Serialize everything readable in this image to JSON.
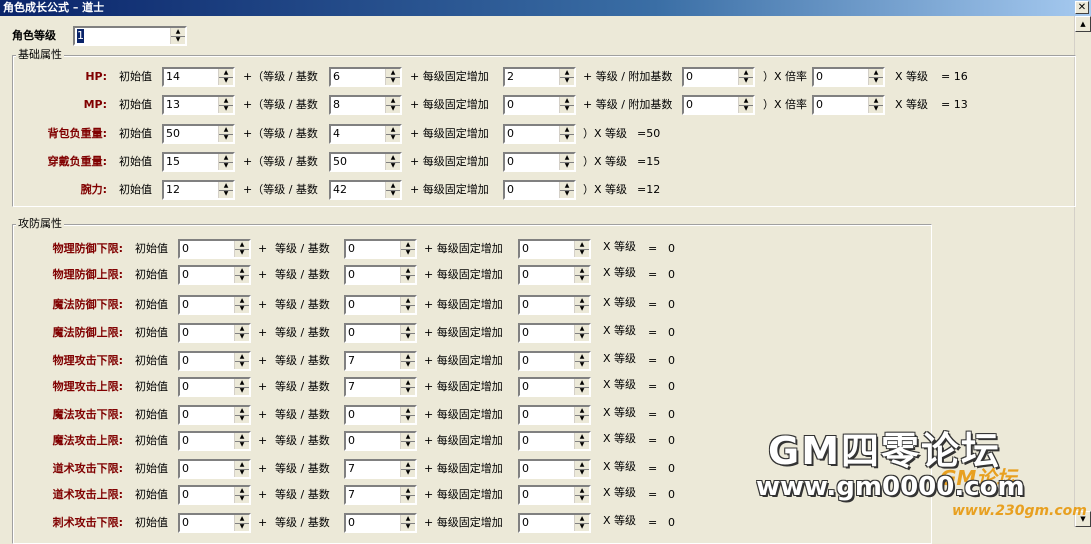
{
  "window": {
    "title": "角色成长公式 – 道士",
    "close": "✕"
  },
  "level": {
    "label": "角色等级",
    "value": "1"
  },
  "base_group": {
    "title": "基础属性",
    "rows": [
      {
        "name": "HP:",
        "init_label": "初始值",
        "init": "14",
        "p1": "+（等级 / 基数",
        "base": "6",
        "p2": "+ 每级固定增加",
        "inc": "2",
        "p3": "+ 等级 / 附加基数",
        "extra": "0",
        "p4": "）X 倍率",
        "mult": "0",
        "p5": "X 等级",
        "result": "=  16"
      },
      {
        "name": "MP:",
        "init_label": "初始值",
        "init": "13",
        "p1": "+（等级 / 基数",
        "base": "8",
        "p2": "+ 每级固定增加",
        "inc": "0",
        "p3": "+ 等级 / 附加基数",
        "extra": "0",
        "p4": "）X 倍率",
        "mult": "0",
        "p5": "X 等级",
        "result": "=  13"
      },
      {
        "name": "背包负重量:",
        "init_label": "初始值",
        "init": "50",
        "p1": "+（等级 / 基数",
        "base": "4",
        "p2": "+ 每级固定增加",
        "inc": "0",
        "p5": "）X 等级",
        "result": "=50"
      },
      {
        "name": "穿戴负重量:",
        "init_label": "初始值",
        "init": "15",
        "p1": "+（等级 / 基数",
        "base": "50",
        "p2": "+ 每级固定增加",
        "inc": "0",
        "p5": "）X 等级",
        "result": "=15"
      },
      {
        "name": "腕力:",
        "init_label": "初始值",
        "init": "12",
        "p1": "+（等级 / 基数",
        "base": "42",
        "p2": "+ 每级固定增加",
        "inc": "0",
        "p5": "）X 等级",
        "result": "=12"
      }
    ]
  },
  "combat_group": {
    "title": "攻防属性",
    "rows": [
      {
        "name": "物理防御下限:",
        "init": "0",
        "base": "0",
        "inc": "0",
        "result": "0"
      },
      {
        "name": "物理防御上限:",
        "init": "0",
        "base": "0",
        "inc": "0",
        "result": "0"
      },
      {
        "name": "魔法防御下限:",
        "init": "0",
        "base": "0",
        "inc": "0",
        "result": "0"
      },
      {
        "name": "魔法防御上限:",
        "init": "0",
        "base": "0",
        "inc": "0",
        "result": "0"
      },
      {
        "name": "物理攻击下限:",
        "init": "0",
        "base": "7",
        "inc": "0",
        "result": "0"
      },
      {
        "name": "物理攻击上限:",
        "init": "0",
        "base": "7",
        "inc": "0",
        "result": "0"
      },
      {
        "name": "魔法攻击下限:",
        "init": "0",
        "base": "0",
        "inc": "0",
        "result": "0"
      },
      {
        "name": "魔法攻击上限:",
        "init": "0",
        "base": "0",
        "inc": "0",
        "result": "0"
      },
      {
        "name": "道术攻击下限:",
        "init": "0",
        "base": "7",
        "inc": "0",
        "result": "0"
      },
      {
        "name": "道术攻击上限:",
        "init": "0",
        "base": "7",
        "inc": "0",
        "result": "0"
      },
      {
        "name": "刺术攻击下限:",
        "init": "0",
        "base": "0",
        "inc": "0",
        "result": "0"
      }
    ],
    "labels": {
      "init": "初始值",
      "plus": "+",
      "level_base": "等级  / 基数",
      "inc": "+ 每级固定增加",
      "x_level": "X 等级",
      "eq": "="
    }
  },
  "watermark": {
    "line1": "GM四零论坛",
    "line2": "www.gm0000.com",
    "line3": "www.230gm.com",
    "logo": "GM论坛"
  }
}
